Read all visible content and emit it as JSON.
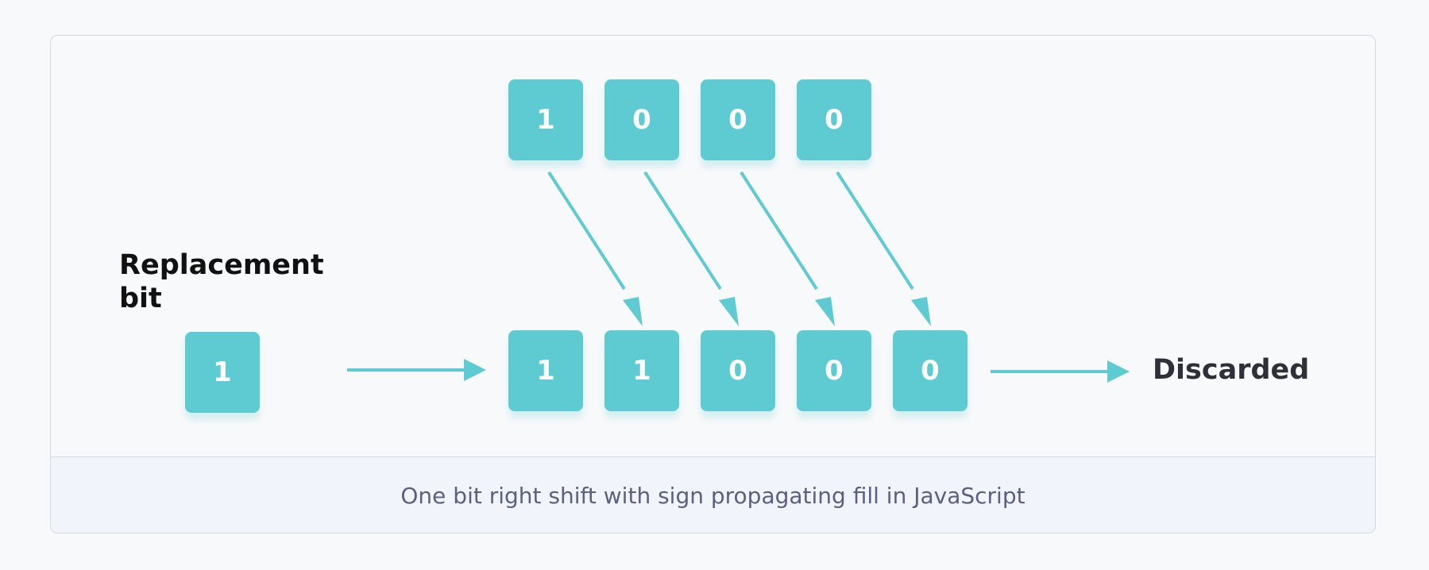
{
  "diagram": {
    "top_bits": [
      "1",
      "0",
      "0",
      "0"
    ],
    "bottom_bits": [
      "1",
      "1",
      "0",
      "0",
      "0"
    ],
    "replacement_bit": "1",
    "replacement_label_line1": "Replacement",
    "replacement_label_line2": "bit",
    "discarded_label": "Discarded",
    "caption": "One bit right shift with sign propagating fill in JavaScript"
  },
  "colors": {
    "bit_fill": "#5ecbd3",
    "arrow": "#5ecbd3",
    "caption_text": "#5b5f82",
    "caption_bg": "#f1f4fa"
  }
}
